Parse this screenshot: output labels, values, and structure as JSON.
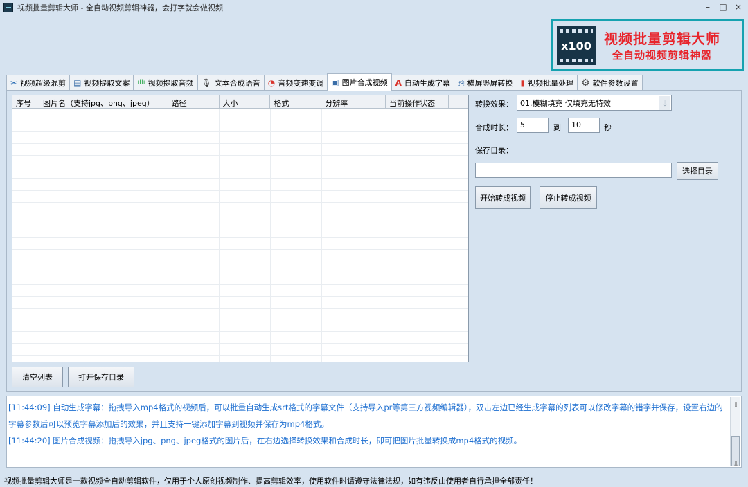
{
  "window": {
    "title": "视频批量剪辑大师 - 全自动视频剪辑神器，会打字就会做视频",
    "minimize": "–",
    "maximize": "□",
    "close": "×"
  },
  "banner": {
    "logo_text": "x100",
    "title": "视频批量剪辑大师",
    "subtitle": "全自动视频剪辑神器"
  },
  "tabs": [
    {
      "label": "视频超级混剪",
      "icon": "scissors-icon",
      "glyph": "✂"
    },
    {
      "label": "视频提取文案",
      "icon": "document-icon",
      "glyph": "▤"
    },
    {
      "label": "视频提取音频",
      "icon": "audio-wave-icon",
      "glyph": "ıllı"
    },
    {
      "label": "文本合成语音",
      "icon": "microphone-icon",
      "glyph": "🎙"
    },
    {
      "label": "音频变速变调",
      "icon": "gauge-icon",
      "glyph": "◔"
    },
    {
      "label": "图片合成视频",
      "icon": "image-icon",
      "glyph": "▣"
    },
    {
      "label": "自动生成字幕",
      "icon": "subtitle-icon",
      "glyph": "A"
    },
    {
      "label": "横屏竖屏转换",
      "icon": "rotate-screen-icon",
      "glyph": "⎘"
    },
    {
      "label": "视频批量处理",
      "icon": "film-icon",
      "glyph": "▮"
    },
    {
      "label": "软件参数设置",
      "icon": "gear-icon",
      "glyph": "⚙"
    }
  ],
  "active_tab": "图片合成视频",
  "table": {
    "columns": [
      "序号",
      "图片名（支持jpg、png、jpeg）",
      "路径",
      "大小",
      "格式",
      "分辨率",
      "当前操作状态"
    ],
    "rows": []
  },
  "buttons": {
    "clear_list": "清空列表",
    "open_save_dir": "打开保存目录",
    "choose_dir": "选择目录",
    "start_convert": "开始转成视频",
    "stop_convert": "停止转成视频"
  },
  "settings": {
    "effect_label": "转换效果：",
    "effect_value": "01.模糊填充 仅填充无特效",
    "duration_label": "合成时长：",
    "duration_from": "5",
    "duration_to_label": "到",
    "duration_to": "10",
    "duration_unit": "秒",
    "save_dir_label": "保存目录：",
    "save_dir_value": ""
  },
  "log": [
    "[11:44:09] 自动生成字幕：拖拽导入mp4格式的视频后，可以批量自动生成srt格式的字幕文件（支持导入pr等第三方视频编辑器），双击左边已经生成字幕的列表可以修改字幕的错字并保存，设置右边的字幕参数后可以预览字幕添加后的效果，并且支持一键添加字幕到视频并保存为mp4格式。",
    "[11:44:20] 图片合成视频：拖拽导入jpg、png、jpeg格式的图片后，在右边选择转换效果和合成时长，即可把图片批量转换成mp4格式的视频。"
  ],
  "statusbar": "视频批量剪辑大师是一款视频全自动剪辑软件，仅用于个人原创视频制作、提高剪辑效率，使用软件时请遵守法律法规，如有违反由使用者自行承担全部责任！",
  "colors": {
    "background": "#d6e3f0",
    "banner_border": "#16a2b0",
    "banner_text": "#e8242b",
    "log_text": "#1e6fd0"
  }
}
